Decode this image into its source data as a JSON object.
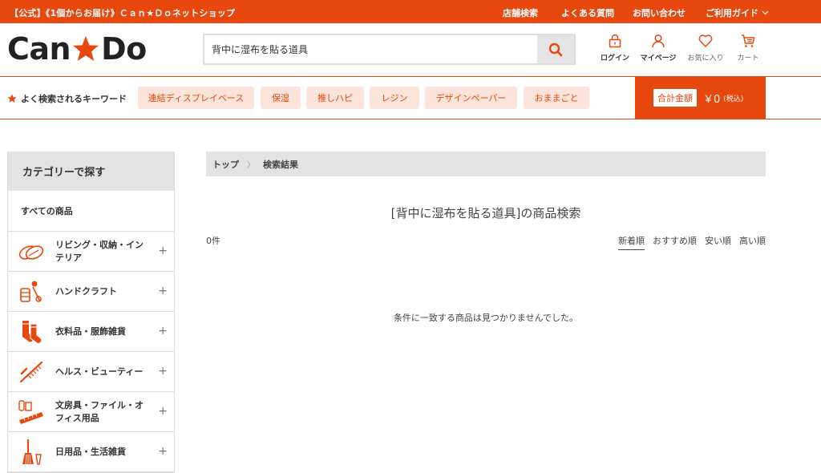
{
  "topbar": {
    "tagline": "【公式】《1個からお届け》Ｃａｎ★Ｄｏネットショップ",
    "links": [
      "店舗検索",
      "よくある質問",
      "お問い合わせ",
      "ご利用ガイド"
    ]
  },
  "header": {
    "logo_text_left": "Can",
    "logo_text_right": "Do",
    "search_value": "背中に湿布を貼る道具",
    "icons": {
      "login": "ログイン",
      "mypage": "マイページ",
      "favorites": "お気に入り",
      "cart": "カート"
    }
  },
  "keywords": {
    "label": "よく検索されるキーワード",
    "items": [
      "連結ディスプレイベース",
      "保湿",
      "推しハピ",
      "レジン",
      "デザインペーパー",
      "おままごと"
    ]
  },
  "cart_total": {
    "label": "合計金額",
    "amount": "￥0",
    "tax": "(税込)"
  },
  "sidebar": {
    "title": "カテゴリーで探す",
    "all": "すべての商品",
    "items": [
      {
        "label": "リビング・収納・インテリア",
        "icon": "sponge-icon"
      },
      {
        "label": "ハンドクラフト",
        "icon": "craft-icon"
      },
      {
        "label": "衣料品・服飾雑貨",
        "icon": "socks-icon"
      },
      {
        "label": "ヘルス・ビューティー",
        "icon": "comb-icon"
      },
      {
        "label": "文房具・ファイル・オフィス用品",
        "icon": "stationery-icon"
      },
      {
        "label": "日用品・生活雑貨",
        "icon": "broom-icon"
      }
    ]
  },
  "main": {
    "breadcrumb": [
      "トップ",
      "検索結果"
    ],
    "result_title": "[背中に湿布を貼る道具]の商品検索",
    "count": "0件",
    "sort": [
      "新着順",
      "おすすめ順",
      "安い順",
      "高い順"
    ],
    "no_results": "条件に一致する商品は見つかりませんでした。"
  },
  "colors": {
    "brand": "#e8480e",
    "keyword_bg": "#fde4da",
    "panel_gray": "#e3e3e3"
  }
}
